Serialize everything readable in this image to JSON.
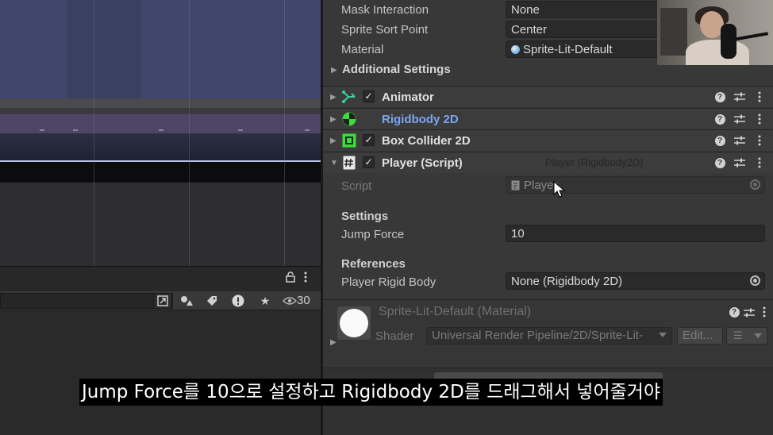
{
  "scene": {
    "toolbar_icons": [
      "lock-icon",
      "kebab-menu-icon"
    ],
    "visibility_count": "30"
  },
  "inspector": {
    "sprite_renderer": {
      "mask_interaction_label": "Mask Interaction",
      "mask_interaction_value": "None",
      "sprite_sort_point_label": "Sprite Sort Point",
      "sprite_sort_point_value": "Center",
      "material_label": "Material",
      "material_value": "Sprite-Lit-Default",
      "additional_settings": "Additional Settings"
    },
    "components": [
      {
        "name": "Animator",
        "enabled": true,
        "icon": "animator-icon"
      },
      {
        "name": "Rigidbody 2D",
        "enabled": null,
        "icon": "rigidbody-icon",
        "highlighted": true
      },
      {
        "name": "Box Collider 2D",
        "enabled": true,
        "icon": "box-collider-icon"
      },
      {
        "name": "Player (Script)",
        "enabled": true,
        "icon": "script-icon",
        "drag_ghost": "Player (Rigidbody2D)"
      }
    ],
    "player_script": {
      "script_label": "Script",
      "script_value": "Player",
      "settings_header": "Settings",
      "jump_force_label": "Jump Force",
      "jump_force_value": "10",
      "references_header": "References",
      "player_rigid_body_label": "Player Rigid Body",
      "player_rigid_body_value": "None (Rigidbody 2D)"
    },
    "material_panel": {
      "name": "Sprite-Lit-Default (Material)",
      "shader_label": "Shader",
      "shader_value": "Universal Render Pipeline/2D/Sprite-Lit-",
      "edit_label": "Edit...",
      "list_label": "☰"
    }
  },
  "subtitle": "Jump Force를 10으로 설정하고 Rigidbody 2D를 드래그해서 넣어줄거야",
  "colors": {
    "inspector_bg": "#383838",
    "highlight_blue": "#7ba6f2",
    "animator_icon": "#37d39a",
    "green_icon": "#3ddc3d",
    "subtitle_bg": "#000000"
  }
}
